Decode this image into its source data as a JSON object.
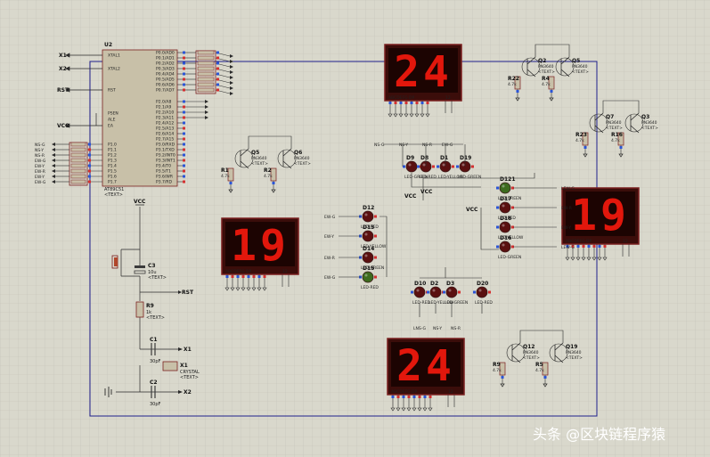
{
  "mcu": {
    "ref": "U2",
    "part": "AT89C51"
  },
  "mcu_left_pins": [
    "XTAL1",
    "XTAL2",
    "RST",
    "PSEN",
    "ALE",
    "EA",
    "P1.0",
    "P1.1",
    "P1.2",
    "P1.3",
    "P1.4",
    "P1.5",
    "P1.6",
    "P1.7"
  ],
  "mcu_right_pins": [
    "P0.0/AD0",
    "P0.1/AD1",
    "P0.2/AD2",
    "P0.3/AD3",
    "P0.4/AD4",
    "P0.5/AD5",
    "P0.6/AD6",
    "P0.7/AD7",
    "P2.0/A8",
    "P2.1/A9",
    "P2.2/A10",
    "P2.3/A11",
    "P2.4/A12",
    "P2.5/A13",
    "P2.6/A14",
    "P2.7/A15",
    "P3.0/RXD",
    "P3.1/TXD",
    "P3.2/INT0",
    "P3.3/INT1",
    "P3.4/T0",
    "P3.5/T1",
    "P3.6/WR",
    "P3.7/RD"
  ],
  "net_labels": {
    "x1": "X1",
    "x2": "X2",
    "rst": "RST",
    "vcc": "VCC",
    "p1": [
      "NS-G",
      "NS-Y",
      "NS-R",
      "EW-G",
      "EW-Y",
      "EW-R",
      "EW-Y",
      "EW-G"
    ]
  },
  "displays": [
    {
      "id": "north",
      "digits": "24",
      "pins": "ABCDEFG DP",
      "num": "12"
    },
    {
      "id": "west",
      "digits": "19",
      "pins": "ABCDEFG DP",
      "num": "12"
    },
    {
      "id": "east",
      "digits": "19",
      "pins": "ABCDEFG DP",
      "num": "12"
    },
    {
      "id": "south",
      "digits": "24",
      "pins": "ABCDEFG DP",
      "num": "12"
    }
  ],
  "transistors": [
    "Q5",
    "Q6",
    "Q2",
    "Q5",
    "Q7",
    "Q3",
    "Q12",
    "Q19"
  ],
  "transistor_part": "PN3640",
  "resistors": [
    "R1",
    "R2",
    "R22",
    "R4",
    "R23",
    "R16",
    "R9",
    "R5"
  ],
  "resistor_value": "4.7k",
  "leds_north": [
    "D9",
    "D8",
    "D1",
    "D19"
  ],
  "leds_west": [
    "D12",
    "D13",
    "D14",
    "D15"
  ],
  "leds_east": [
    "D121",
    "D17",
    "D18",
    "D16"
  ],
  "leds_south": [
    "D10",
    "D2",
    "D3",
    "D20"
  ],
  "led_parts": [
    "LED-GREEN",
    "LED-RED",
    "LED-YELLOW"
  ],
  "caps": {
    "c1": "C1",
    "c1v": "30pF",
    "c2": "C2",
    "c2v": "30pF",
    "c3": "C3",
    "c3v": "10u"
  },
  "crystal": {
    "ref": "X1",
    "part": "CRYSTAL"
  },
  "r9": {
    "ref": "R9",
    "val": "1k"
  },
  "text_placeholder": "<TEXT>",
  "watermark": "头条 @区块链程序猿"
}
